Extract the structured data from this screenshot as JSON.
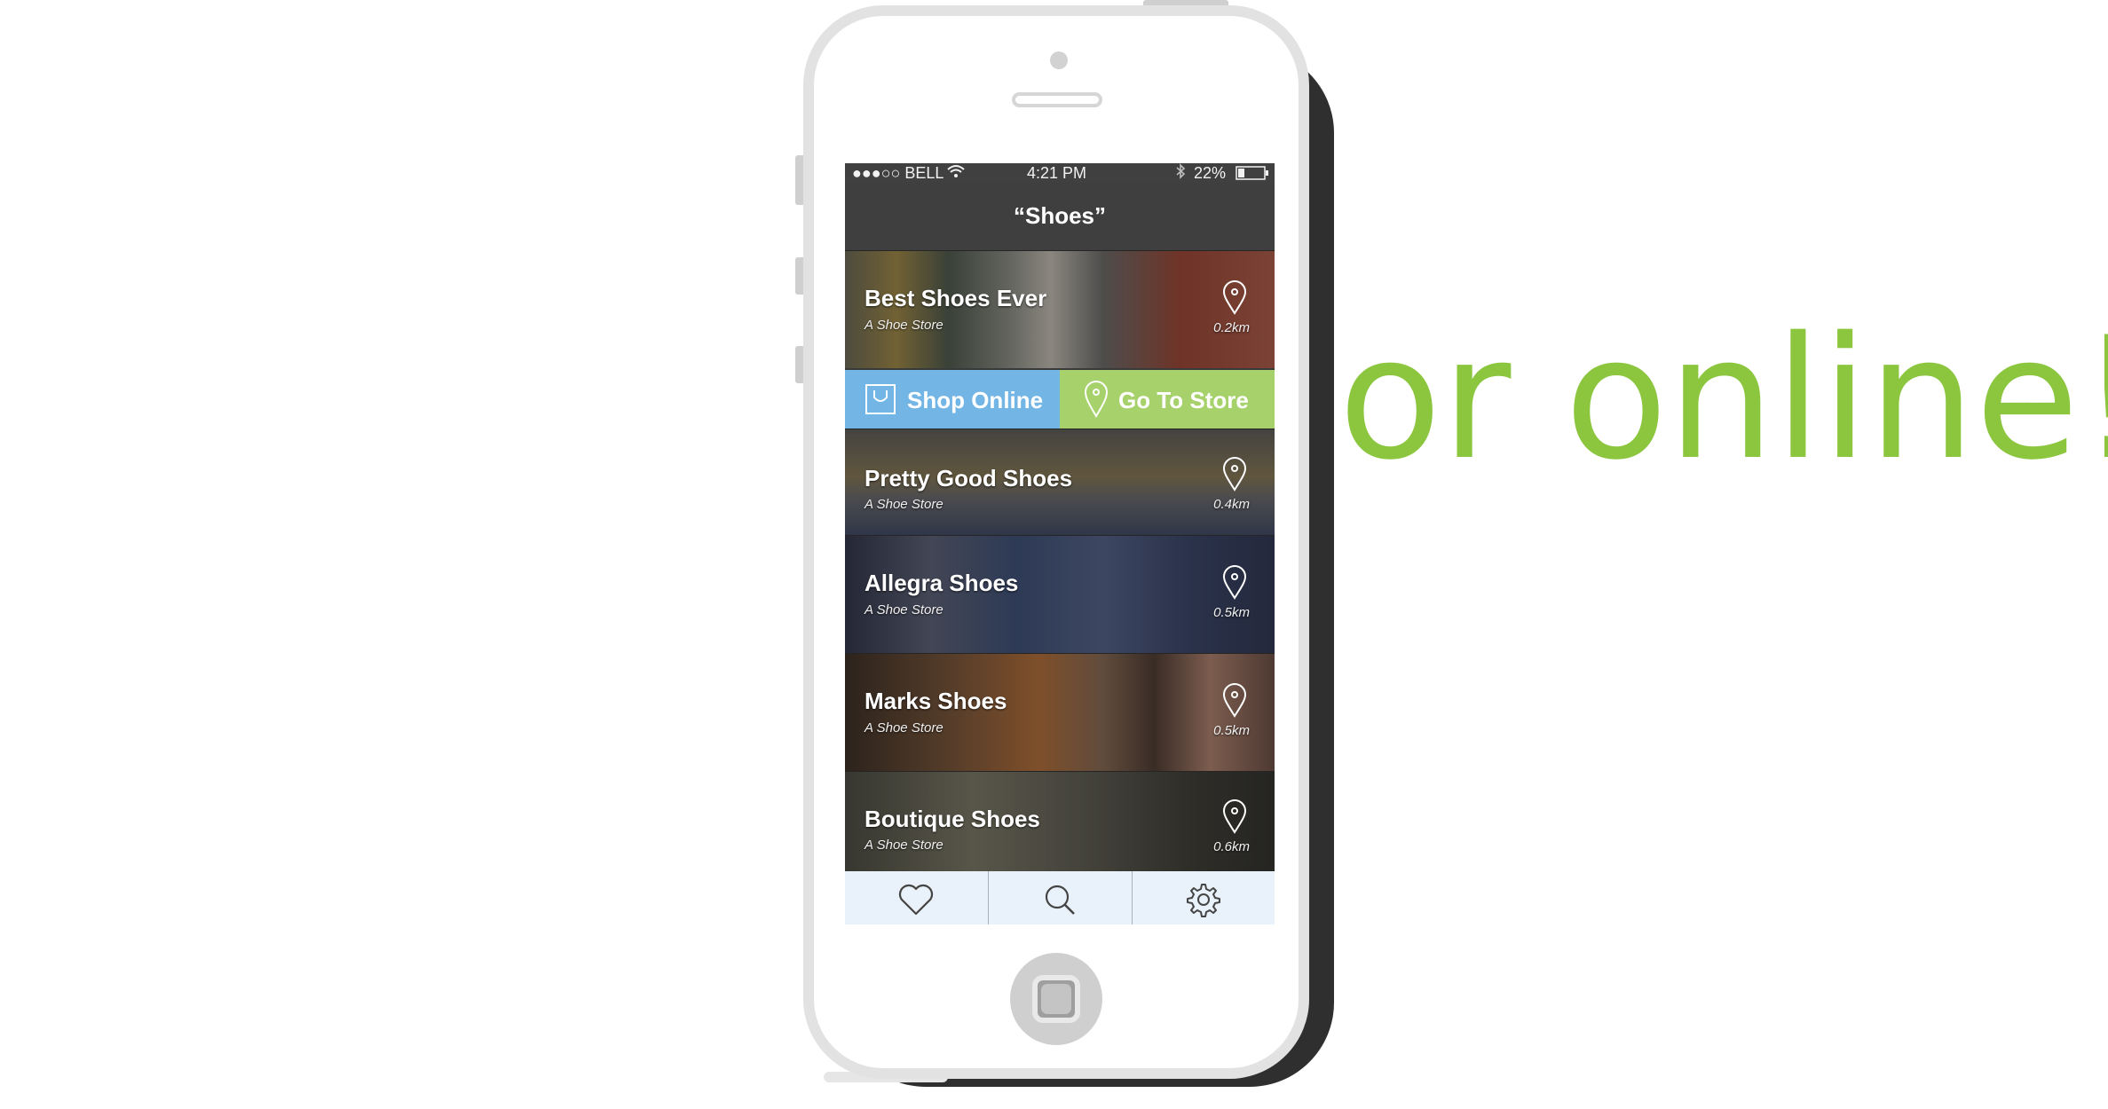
{
  "status_bar": {
    "carrier": "●●●○○ BELL",
    "time": "4:21 PM",
    "battery": "22%"
  },
  "nav": {
    "title": "“Shoes”"
  },
  "stores": [
    {
      "name": "Best Shoes Ever",
      "subtitle": "A Shoe Store",
      "distance": "0.2km"
    },
    {
      "name": "Pretty Good Shoes",
      "subtitle": "A Shoe Store",
      "distance": "0.4km"
    },
    {
      "name": "Allegra Shoes",
      "subtitle": "A Shoe Store",
      "distance": "0.5km"
    },
    {
      "name": "Marks Shoes",
      "subtitle": "A Shoe Store",
      "distance": "0.5km"
    },
    {
      "name": "Boutique Shoes",
      "subtitle": "A Shoe Store",
      "distance": "0.6km"
    }
  ],
  "actions": {
    "shop_online": "Shop Online",
    "go_to_store": "Go To Store",
    "shop_online_color": "#73b5e5",
    "go_to_store_color": "#a6d16b"
  },
  "tab_bar": {
    "tabs": [
      {
        "icon": "heart-icon"
      },
      {
        "icon": "search-icon"
      },
      {
        "icon": "gear-icon"
      }
    ]
  },
  "tagline": "or online!",
  "colors": {
    "accent": "#8cc63f"
  }
}
